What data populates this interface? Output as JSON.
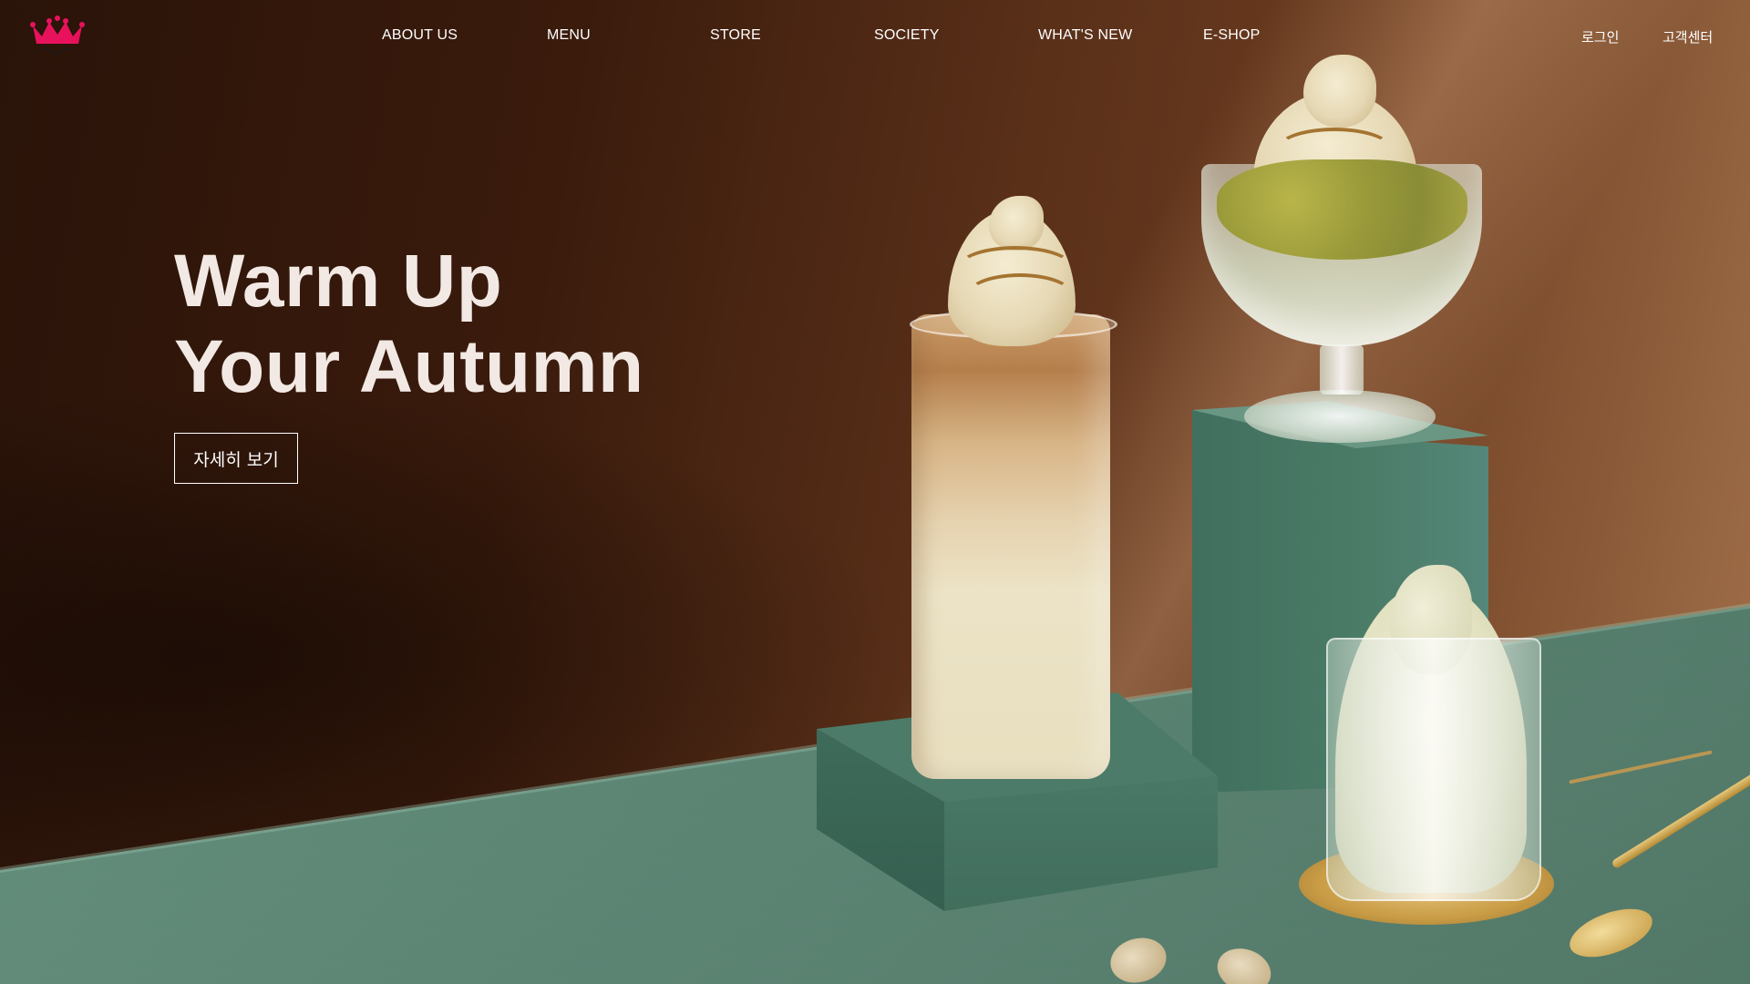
{
  "brand": {
    "logo_icon": "crown-logo-icon",
    "logo_color": "#e8125c"
  },
  "nav": {
    "items": [
      {
        "label": "ABOUT US"
      },
      {
        "label": "MENU"
      },
      {
        "label": "STORE"
      },
      {
        "label": "SOCIETY"
      },
      {
        "label": "WHAT'S NEW"
      },
      {
        "label": "E-SHOP"
      }
    ]
  },
  "utility": {
    "login": "로그인",
    "customer_center": "고객센터"
  },
  "hero": {
    "headline_line1": "Warm Up",
    "headline_line2": "Your Autumn",
    "cta_label": "자세히 보기",
    "background_color": "#3a1b0c",
    "table_color": "#5f8b79"
  }
}
